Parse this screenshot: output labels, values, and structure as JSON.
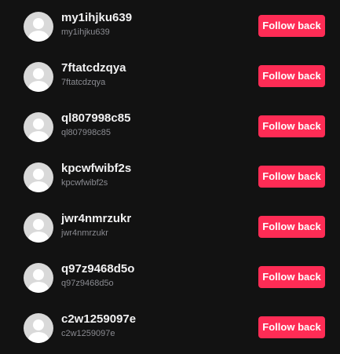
{
  "accent_color": "#fe2c55",
  "avatar_icon": "default-user-avatar-icon",
  "followers": [
    {
      "display_name": "my1ihjku639",
      "username": "my1ihjku639",
      "button_label": "Follow back"
    },
    {
      "display_name": "7ftatcdzqya",
      "username": "7ftatcdzqya",
      "button_label": "Follow back"
    },
    {
      "display_name": "ql807998c85",
      "username": "ql807998c85",
      "button_label": "Follow back"
    },
    {
      "display_name": "kpcwfwibf2s",
      "username": "kpcwfwibf2s",
      "button_label": "Follow back"
    },
    {
      "display_name": "jwr4nmrzukr",
      "username": "jwr4nmrzukr",
      "button_label": "Follow back"
    },
    {
      "display_name": "q97z9468d5o",
      "username": "q97z9468d5o",
      "button_label": "Follow back"
    },
    {
      "display_name": "c2w1259097e",
      "username": "c2w1259097e",
      "button_label": "Follow back"
    }
  ]
}
